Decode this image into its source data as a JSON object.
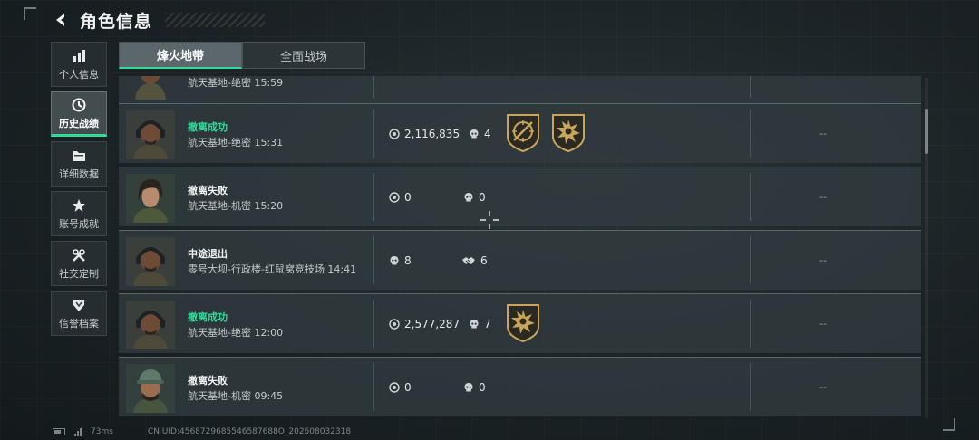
{
  "header": {
    "title": "角色信息"
  },
  "sidebar": {
    "items": [
      {
        "label": "个人信息",
        "icon": "bar-chart-icon",
        "active": false
      },
      {
        "label": "历史战绩",
        "icon": "history-clock-icon",
        "active": true
      },
      {
        "label": "详细数据",
        "icon": "folder-icon",
        "active": false
      },
      {
        "label": "账号成就",
        "icon": "achievement-icon",
        "active": false
      },
      {
        "label": "社交定制",
        "icon": "tools-icon",
        "active": false
      },
      {
        "label": "信誉档案",
        "icon": "shield-icon",
        "active": false
      }
    ]
  },
  "tabs": [
    {
      "label": "烽火地带",
      "active": true
    },
    {
      "label": "全面战场",
      "active": false
    }
  ],
  "records": [
    {
      "status": "",
      "map": "航天基地-绝密 15:59",
      "status_color": ""
    },
    {
      "status": "撤离成功",
      "map": "航天基地-绝密 15:31",
      "status_color": "#2fdc9a",
      "stat1": {
        "icon": "coin-icon",
        "value": "2,116,835"
      },
      "stat2": {
        "icon": "skull-icon",
        "value": "4"
      },
      "badges": [
        "sniper-badge-icon",
        "blast-badge-icon"
      ],
      "extra": "--"
    },
    {
      "status": "撤离失败",
      "map": "航天基地-机密 15:20",
      "stat1": {
        "icon": "coin-icon",
        "value": "0"
      },
      "stat2": {
        "icon": "skull-icon",
        "value": "0"
      },
      "badges": [],
      "extra": "--"
    },
    {
      "status": "中途退出",
      "map": "零号大坝-行政楼-红鼠窝竞技场 14:41",
      "stat1": {
        "icon": "skull-icon",
        "value": "8"
      },
      "stat2": {
        "icon": "handshake-icon",
        "value": "6"
      },
      "badges": [],
      "extra": "--"
    },
    {
      "status": "撤离成功",
      "map": "航天基地-绝密 12:00",
      "status_color": "#2fdc9a",
      "stat1": {
        "icon": "coin-icon",
        "value": "2,577,287"
      },
      "stat2": {
        "icon": "skull-icon",
        "value": "7"
      },
      "badges": [
        "blast-badge-icon"
      ],
      "extra": "--"
    },
    {
      "status": "撤离失败",
      "map": "航天基地-机密 09:45",
      "stat1": {
        "icon": "coin-icon",
        "value": "0"
      },
      "stat2": {
        "icon": "skull-icon",
        "value": "0"
      },
      "badges": [],
      "extra": "--"
    }
  ],
  "footer": {
    "ping": "73ms",
    "uid": "CN UID:4568729685546587688O_202608032318"
  },
  "colors": {
    "accent": "#2fdc9a",
    "badge_gold": "#c8a55b"
  }
}
